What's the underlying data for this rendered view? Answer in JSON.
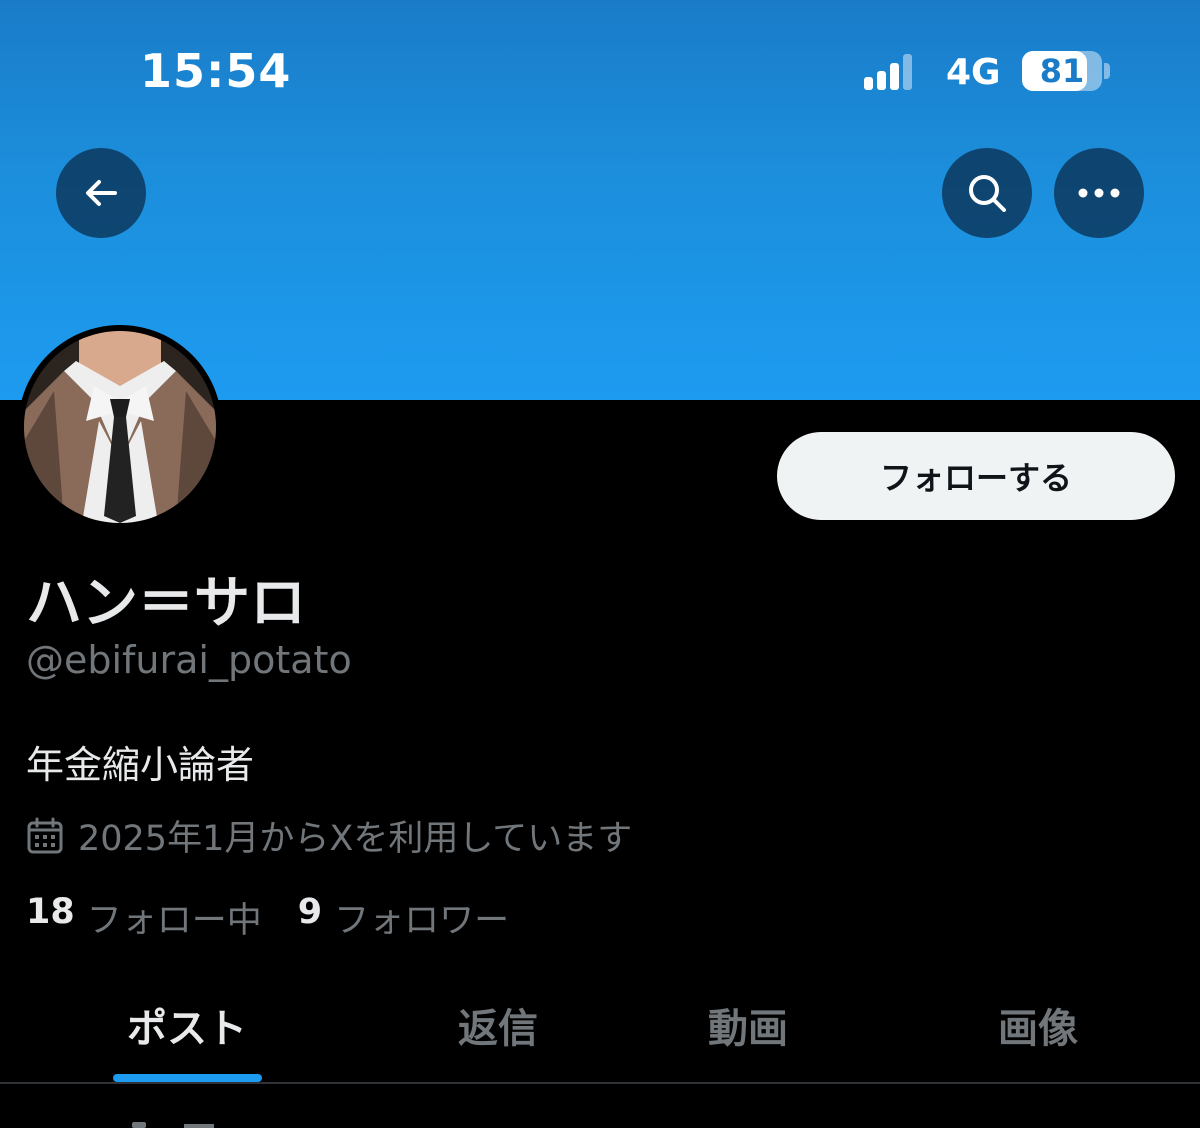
{
  "status_bar": {
    "time": "15:54",
    "network": "4G",
    "battery": "81",
    "battery_level": 0.81
  },
  "header": {
    "back_icon": "arrow-left-icon",
    "search_icon": "search-icon",
    "more_icon": "more-horizontal-icon",
    "banner_color": "#1d9bf0"
  },
  "profile": {
    "display_name": "ハン＝サロ",
    "handle": "@ebifurai_potato",
    "bio": "年金縮小論者",
    "joined": "2025年1月からXを利用しています",
    "joined_icon": "calendar-icon",
    "follow_label": "フォローする",
    "following_count": "18",
    "following_label": "フォロー中",
    "followers_count": "9",
    "followers_label": "フォロワー"
  },
  "tabs": [
    {
      "label": "ポスト",
      "active": true
    },
    {
      "label": "返信",
      "active": false
    },
    {
      "label": "動画",
      "active": false
    },
    {
      "label": "画像",
      "active": false
    }
  ],
  "colors": {
    "accent": "#1d9bf0",
    "background": "#000000",
    "text_primary": "#e7e9ea",
    "text_secondary": "#71767b"
  }
}
